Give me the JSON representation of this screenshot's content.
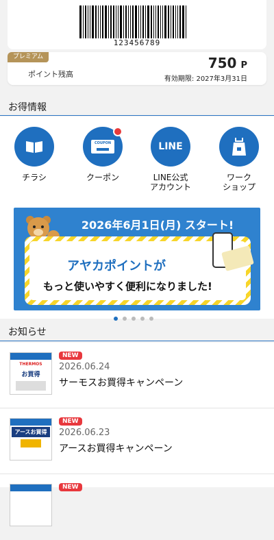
{
  "barcode": {
    "number": "123456789"
  },
  "points": {
    "badge": "プレミアム",
    "label": "ポイント残高",
    "value": "750",
    "unit": "P",
    "expiry": "有効期限: 2027年3月31日"
  },
  "benefits": {
    "title": "お得情報",
    "items": [
      {
        "label": "チラシ",
        "icon": "flyer-book-icon"
      },
      {
        "label": "クーポン",
        "icon": "coupon-icon",
        "icon_text": "COUPON",
        "has_notification": true
      },
      {
        "label": "LINE公式\nアカウント",
        "icon": "line-icon",
        "icon_text": "LINE"
      },
      {
        "label": "ワーク\nショップ",
        "icon": "apron-icon"
      }
    ]
  },
  "banner": {
    "headline": "2026年6月1日(月) スタート!",
    "line1": "アヤカポイントが",
    "line2": "もっと使いやすく便利になりました!",
    "pager": {
      "count": 5,
      "active_index": 0
    }
  },
  "news": {
    "title": "お知らせ",
    "items": [
      {
        "badge": "NEW",
        "date": "2026.06.24",
        "title": "サーモスお買得キャンペーン",
        "thumb_brand": "THERMOS",
        "thumb_heading": "お買得"
      },
      {
        "badge": "NEW",
        "date": "2026.06.23",
        "title": "アースお買得キャンペーン",
        "thumb_brand": "",
        "thumb_heading": "アースお買得"
      },
      {
        "badge": "NEW"
      }
    ]
  },
  "colors": {
    "accent": "#1f6fbf",
    "premium": "#b59459",
    "new_badge": "#e8383d",
    "banner_bg": "#2f82cf"
  }
}
